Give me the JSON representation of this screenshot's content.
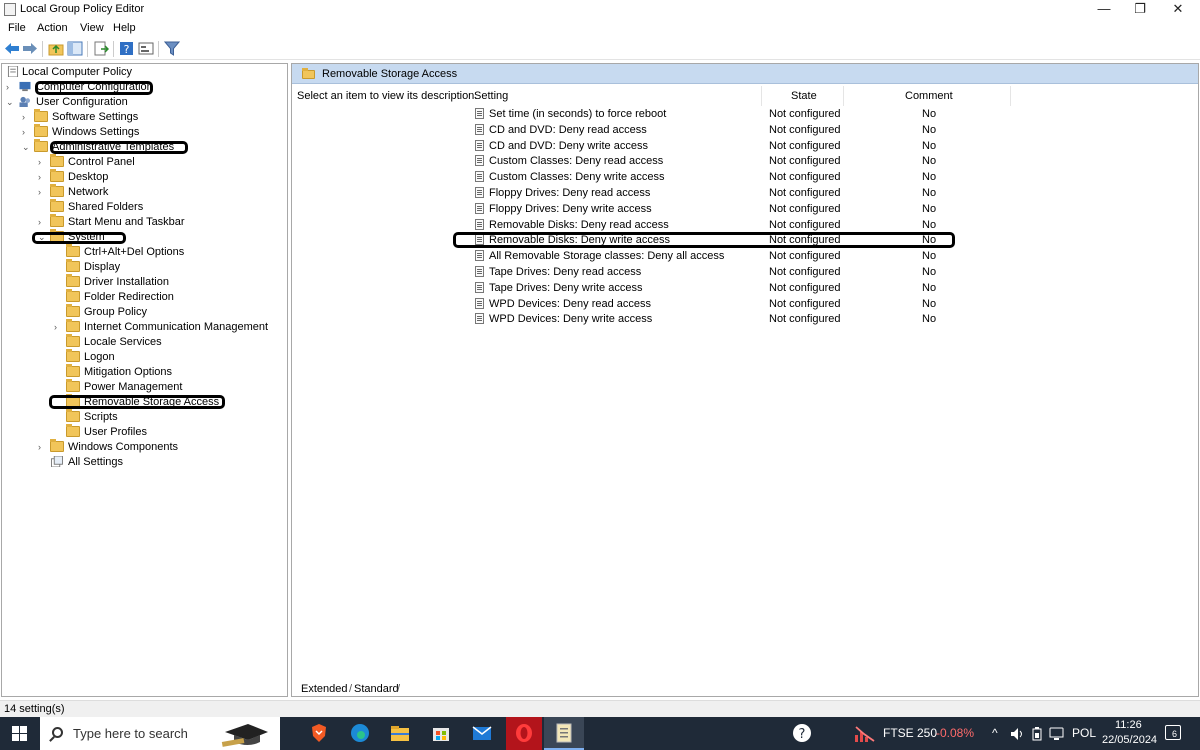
{
  "window": {
    "title": "Local Group Policy Editor",
    "minimize": "—",
    "restore": "❐",
    "close": "✕"
  },
  "menu": [
    "File",
    "Action",
    "View",
    "Help"
  ],
  "tree": {
    "items": [
      {
        "label": "Local Computer Policy",
        "name": "tree-local-computer-policy"
      },
      {
        "label": "Computer Configuration",
        "name": "tree-computer-configuration"
      },
      {
        "label": "User Configuration",
        "name": "tree-user-configuration"
      },
      {
        "label": "Software Settings",
        "name": "tree-software-settings"
      },
      {
        "label": "Windows Settings",
        "name": "tree-windows-settings"
      },
      {
        "label": "Administrative Templates",
        "name": "tree-administrative-templates"
      },
      {
        "label": "Control Panel",
        "name": "tree-control-panel"
      },
      {
        "label": "Desktop",
        "name": "tree-desktop"
      },
      {
        "label": "Network",
        "name": "tree-network"
      },
      {
        "label": "Shared Folders",
        "name": "tree-shared-folders"
      },
      {
        "label": "Start Menu and Taskbar",
        "name": "tree-start-menu-and-taskbar"
      },
      {
        "label": "System",
        "name": "tree-system"
      },
      {
        "label": "Ctrl+Alt+Del Options",
        "name": "tree-ctrl-alt-del-options"
      },
      {
        "label": "Display",
        "name": "tree-display"
      },
      {
        "label": "Driver Installation",
        "name": "tree-driver-installation"
      },
      {
        "label": "Folder Redirection",
        "name": "tree-folder-redirection"
      },
      {
        "label": "Group Policy",
        "name": "tree-group-policy"
      },
      {
        "label": "Internet Communication Management",
        "name": "tree-internet-communication-management"
      },
      {
        "label": "Locale Services",
        "name": "tree-locale-services"
      },
      {
        "label": "Logon",
        "name": "tree-logon"
      },
      {
        "label": "Mitigation Options",
        "name": "tree-mitigation-options"
      },
      {
        "label": "Power Management",
        "name": "tree-power-management"
      },
      {
        "label": "Removable Storage Access",
        "name": "tree-removable-storage-access"
      },
      {
        "label": "Scripts",
        "name": "tree-scripts"
      },
      {
        "label": "User Profiles",
        "name": "tree-user-profiles"
      },
      {
        "label": "Windows Components",
        "name": "tree-windows-components"
      },
      {
        "label": "All Settings",
        "name": "tree-all-settings"
      }
    ]
  },
  "right": {
    "header": "Removable Storage Access",
    "description": "Select an item to view its description.",
    "columns": {
      "setting": "Setting",
      "state": "State",
      "comment": "Comment"
    },
    "rows": [
      {
        "setting": "Set time (in seconds) to force reboot",
        "state": "Not configured",
        "comment": "No"
      },
      {
        "setting": "CD and DVD: Deny read access",
        "state": "Not configured",
        "comment": "No"
      },
      {
        "setting": "CD and DVD: Deny write access",
        "state": "Not configured",
        "comment": "No"
      },
      {
        "setting": "Custom Classes: Deny read access",
        "state": "Not configured",
        "comment": "No"
      },
      {
        "setting": "Custom Classes: Deny write access",
        "state": "Not configured",
        "comment": "No"
      },
      {
        "setting": "Floppy Drives: Deny read access",
        "state": "Not configured",
        "comment": "No"
      },
      {
        "setting": "Floppy Drives: Deny write access",
        "state": "Not configured",
        "comment": "No"
      },
      {
        "setting": "Removable Disks: Deny read access",
        "state": "Not configured",
        "comment": "No"
      },
      {
        "setting": "Removable Disks: Deny write access",
        "state": "Not configured",
        "comment": "No"
      },
      {
        "setting": "All Removable Storage classes: Deny all access",
        "state": "Not configured",
        "comment": "No"
      },
      {
        "setting": "Tape Drives: Deny read access",
        "state": "Not configured",
        "comment": "No"
      },
      {
        "setting": "Tape Drives: Deny write access",
        "state": "Not configured",
        "comment": "No"
      },
      {
        "setting": "WPD Devices: Deny read access",
        "state": "Not configured",
        "comment": "No"
      },
      {
        "setting": "WPD Devices: Deny write access",
        "state": "Not configured",
        "comment": "No"
      }
    ],
    "tabs": [
      "Extended",
      "Standard"
    ]
  },
  "status": "14 setting(s)",
  "taskbar": {
    "search_placeholder": "Type here to search",
    "ticker_name": "FTSE 250",
    "ticker_change": "-0.08%",
    "language": "POL",
    "time": "11:26",
    "date": "22/05/2024",
    "notifications": "6",
    "tray_chevron": "^"
  },
  "colors": {
    "header_bg": "#c7daf0",
    "taskbar_bg": "#1f2a38",
    "ticker_negative": "#ff6b6b",
    "folder": "#f1c55a"
  }
}
